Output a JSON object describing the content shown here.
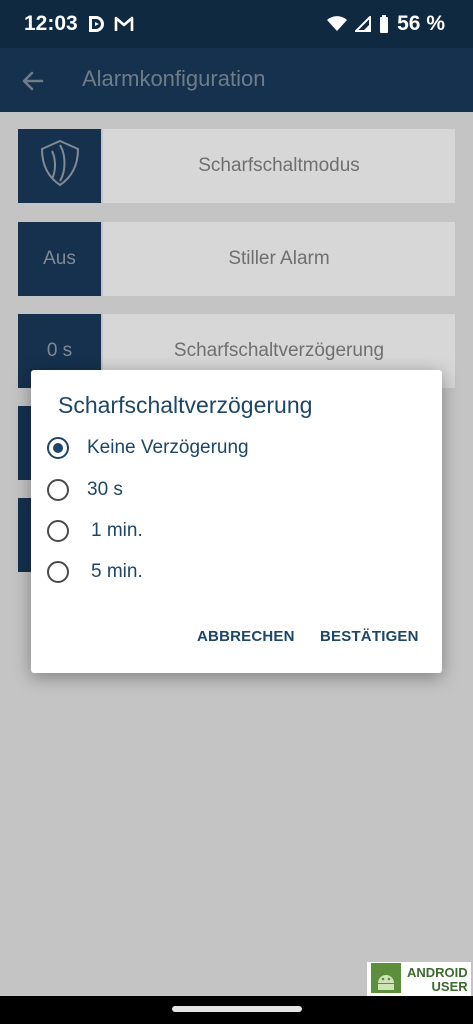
{
  "status_bar": {
    "time": "12:03",
    "battery": "56 %"
  },
  "app_bar": {
    "title": "Alarmkonfiguration"
  },
  "rows": [
    {
      "badge": "",
      "label": "Scharfschaltmodus"
    },
    {
      "badge": "Aus",
      "label": "Stiller Alarm"
    },
    {
      "badge": "0 s",
      "label": "Scharfschaltverzögerung"
    }
  ],
  "dialog": {
    "title": "Scharfschaltverzögerung",
    "options": [
      {
        "label": "Keine Verzögerung",
        "selected": true
      },
      {
        "label": "30 s",
        "selected": false
      },
      {
        "label": "1 min.",
        "selected": false
      },
      {
        "label": "5 min.",
        "selected": false
      }
    ],
    "cancel_label": "ABBRECHEN",
    "confirm_label": "BESTÄTIGEN"
  },
  "watermark": {
    "line1": "ANDROID",
    "line2": "USER"
  },
  "colors": {
    "primary": "#15314e",
    "status_bar": "#0f2940",
    "accent": "#1d4667",
    "scrim": "#c4c4c4"
  }
}
